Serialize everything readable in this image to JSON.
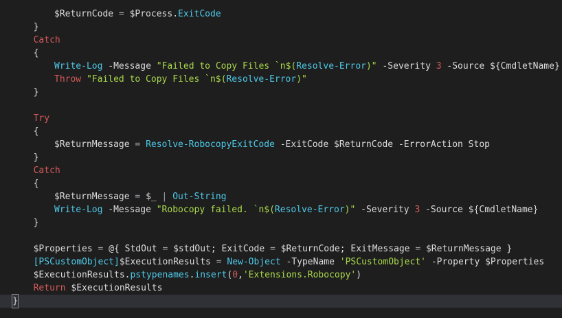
{
  "colors": {
    "background": "#1e1e1e",
    "current_line": "#2f3136",
    "keyword": "#d65a5a",
    "cmdlet": "#4ec9e8",
    "string": "#aad94c",
    "text": "#dcdcdc"
  },
  "lines": [
    {
      "indent": 10,
      "tokens": [
        {
          "t": "var",
          "v": "$ReturnCode"
        },
        {
          "t": "op",
          "v": " = "
        },
        {
          "t": "var",
          "v": "$Process"
        },
        {
          "t": "punc",
          "v": "."
        },
        {
          "t": "member",
          "v": "ExitCode"
        }
      ]
    },
    {
      "indent": 6,
      "tokens": [
        {
          "t": "punc",
          "v": "}"
        }
      ]
    },
    {
      "indent": 6,
      "tokens": [
        {
          "t": "kw",
          "v": "Catch"
        }
      ]
    },
    {
      "indent": 6,
      "tokens": [
        {
          "t": "punc",
          "v": "{"
        }
      ]
    },
    {
      "indent": 10,
      "tokens": [
        {
          "t": "cmd",
          "v": "Write-Log"
        },
        {
          "t": "plain",
          "v": " "
        },
        {
          "t": "param",
          "v": "-Message"
        },
        {
          "t": "plain",
          "v": " "
        },
        {
          "t": "str",
          "v": "\"Failed to Copy Files `n$("
        },
        {
          "t": "cmd",
          "v": "Resolve-Error"
        },
        {
          "t": "str",
          "v": ")\""
        },
        {
          "t": "plain",
          "v": " "
        },
        {
          "t": "param",
          "v": "-Severity"
        },
        {
          "t": "plain",
          "v": " "
        },
        {
          "t": "num",
          "v": "3"
        },
        {
          "t": "plain",
          "v": " "
        },
        {
          "t": "param",
          "v": "-Source"
        },
        {
          "t": "plain",
          "v": " "
        },
        {
          "t": "var",
          "v": "${CmdletName}"
        }
      ]
    },
    {
      "indent": 10,
      "tokens": [
        {
          "t": "kw",
          "v": "Throw"
        },
        {
          "t": "plain",
          "v": " "
        },
        {
          "t": "str",
          "v": "\"Failed to Copy Files `n$("
        },
        {
          "t": "cmd",
          "v": "Resolve-Error"
        },
        {
          "t": "str",
          "v": ")\""
        }
      ]
    },
    {
      "indent": 6,
      "tokens": [
        {
          "t": "punc",
          "v": "}"
        }
      ]
    },
    {
      "indent": 6,
      "tokens": []
    },
    {
      "indent": 6,
      "tokens": [
        {
          "t": "kw",
          "v": "Try"
        }
      ]
    },
    {
      "indent": 6,
      "tokens": [
        {
          "t": "punc",
          "v": "{"
        }
      ]
    },
    {
      "indent": 10,
      "tokens": [
        {
          "t": "var",
          "v": "$ReturnMessage"
        },
        {
          "t": "op",
          "v": " = "
        },
        {
          "t": "cmd",
          "v": "Resolve-RobocopyExitCode"
        },
        {
          "t": "plain",
          "v": " "
        },
        {
          "t": "param",
          "v": "-ExitCode"
        },
        {
          "t": "plain",
          "v": " "
        },
        {
          "t": "var",
          "v": "$ReturnCode"
        },
        {
          "t": "plain",
          "v": " "
        },
        {
          "t": "param",
          "v": "-ErrorAction"
        },
        {
          "t": "plain",
          "v": " Stop"
        }
      ]
    },
    {
      "indent": 6,
      "tokens": [
        {
          "t": "punc",
          "v": "}"
        }
      ]
    },
    {
      "indent": 6,
      "tokens": [
        {
          "t": "kw",
          "v": "Catch"
        }
      ]
    },
    {
      "indent": 6,
      "tokens": [
        {
          "t": "punc",
          "v": "{"
        }
      ]
    },
    {
      "indent": 10,
      "tokens": [
        {
          "t": "var",
          "v": "$ReturnMessage"
        },
        {
          "t": "op",
          "v": " = "
        },
        {
          "t": "var",
          "v": "$_"
        },
        {
          "t": "op",
          "v": " | "
        },
        {
          "t": "cmd",
          "v": "Out-String"
        }
      ]
    },
    {
      "indent": 10,
      "tokens": [
        {
          "t": "cmd",
          "v": "Write-Log"
        },
        {
          "t": "plain",
          "v": " "
        },
        {
          "t": "param",
          "v": "-Message"
        },
        {
          "t": "plain",
          "v": " "
        },
        {
          "t": "str",
          "v": "\"Robocopy failed. `n$("
        },
        {
          "t": "cmd",
          "v": "Resolve-Error"
        },
        {
          "t": "str",
          "v": ")\""
        },
        {
          "t": "plain",
          "v": " "
        },
        {
          "t": "param",
          "v": "-Severity"
        },
        {
          "t": "plain",
          "v": " "
        },
        {
          "t": "num",
          "v": "3"
        },
        {
          "t": "plain",
          "v": " "
        },
        {
          "t": "param",
          "v": "-Source"
        },
        {
          "t": "plain",
          "v": " "
        },
        {
          "t": "var",
          "v": "${CmdletName}"
        }
      ]
    },
    {
      "indent": 6,
      "tokens": [
        {
          "t": "punc",
          "v": "}"
        }
      ]
    },
    {
      "indent": 6,
      "tokens": []
    },
    {
      "indent": 6,
      "tokens": [
        {
          "t": "var",
          "v": "$Properties"
        },
        {
          "t": "op",
          "v": " = "
        },
        {
          "t": "plain",
          "v": "@{ StdOut "
        },
        {
          "t": "op",
          "v": "="
        },
        {
          "t": "plain",
          "v": " "
        },
        {
          "t": "var",
          "v": "$stdOut"
        },
        {
          "t": "plain",
          "v": "; ExitCode "
        },
        {
          "t": "op",
          "v": "="
        },
        {
          "t": "plain",
          "v": " "
        },
        {
          "t": "var",
          "v": "$ReturnCode"
        },
        {
          "t": "plain",
          "v": "; ExitMessage "
        },
        {
          "t": "op",
          "v": "="
        },
        {
          "t": "plain",
          "v": " "
        },
        {
          "t": "var",
          "v": "$ReturnMessage"
        },
        {
          "t": "plain",
          "v": " }"
        }
      ]
    },
    {
      "indent": 6,
      "tokens": [
        {
          "t": "type",
          "v": "[PSCustomObject]"
        },
        {
          "t": "var",
          "v": "$ExecutionResults"
        },
        {
          "t": "op",
          "v": " = "
        },
        {
          "t": "cmd",
          "v": "New-Object"
        },
        {
          "t": "plain",
          "v": " "
        },
        {
          "t": "param",
          "v": "-TypeName"
        },
        {
          "t": "plain",
          "v": " "
        },
        {
          "t": "str",
          "v": "'PSCustomObject'"
        },
        {
          "t": "plain",
          "v": " "
        },
        {
          "t": "param",
          "v": "-Property"
        },
        {
          "t": "plain",
          "v": " "
        },
        {
          "t": "var",
          "v": "$Properties"
        }
      ]
    },
    {
      "indent": 6,
      "tokens": [
        {
          "t": "var",
          "v": "$ExecutionResults"
        },
        {
          "t": "punc",
          "v": "."
        },
        {
          "t": "member",
          "v": "pstypenames"
        },
        {
          "t": "punc",
          "v": "."
        },
        {
          "t": "member",
          "v": "insert"
        },
        {
          "t": "punc",
          "v": "("
        },
        {
          "t": "num",
          "v": "0"
        },
        {
          "t": "punc",
          "v": ","
        },
        {
          "t": "str",
          "v": "'Extensions.Robocopy'"
        },
        {
          "t": "punc",
          "v": ")"
        }
      ]
    },
    {
      "indent": 6,
      "tokens": [
        {
          "t": "kw",
          "v": "Return"
        },
        {
          "t": "plain",
          "v": " "
        },
        {
          "t": "var",
          "v": "$ExecutionResults"
        }
      ]
    },
    {
      "indent": 2,
      "current": true,
      "caret": true,
      "tokens": [
        {
          "t": "punc",
          "v": "}"
        }
      ]
    }
  ]
}
